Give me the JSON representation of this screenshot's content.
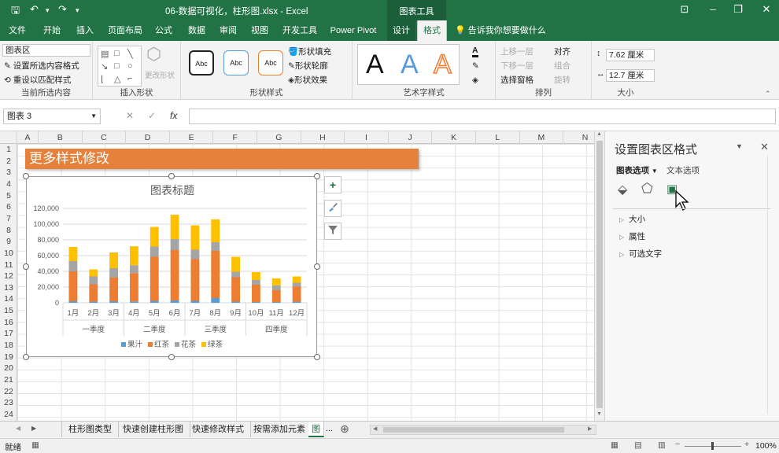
{
  "window": {
    "title": "06-数据可视化，柱形图.xlsx  -  Excel",
    "context_tools": "图表工具"
  },
  "tabs": [
    "文件",
    "开始",
    "插入",
    "页面布局",
    "公式",
    "数据",
    "审阅",
    "视图",
    "开发工具",
    "Power Pivot",
    "设计",
    "格式"
  ],
  "active_tab": "格式",
  "tell_me": "告诉我你想要做什么",
  "ribbon": {
    "current_selection": {
      "combo_value": "图表区",
      "format_selection": "设置所选内容格式",
      "reset_style": "重设以匹配样式",
      "label": "当前所选内容"
    },
    "insert_shapes": {
      "change_shape": "更改形状",
      "label": "插入形状"
    },
    "shape_styles": {
      "preset_text": "Abc",
      "fill": "形状填充",
      "outline": "形状轮廓",
      "effects": "形状效果",
      "label": "形状样式"
    },
    "wordart": {
      "glyph": "A",
      "label": "艺术字样式"
    },
    "arrange": {
      "bring_forward": "上移一层",
      "send_backward": "下移一层",
      "selection_pane": "选择窗格",
      "align": "对齐",
      "group": "组合",
      "rotate": "旋转",
      "label": "排列"
    },
    "size": {
      "height": "7.62 厘米",
      "width": "12.7 厘米",
      "label": "大小"
    }
  },
  "formula_bar": {
    "name_box": "图表 3",
    "fx": "fx",
    "formula": ""
  },
  "columns": [
    "A",
    "B",
    "C",
    "D",
    "E",
    "F",
    "G",
    "H",
    "I",
    "J",
    "K",
    "L",
    "M",
    "N"
  ],
  "rows": [
    "1",
    "2",
    "3",
    "4",
    "5",
    "6",
    "7",
    "8",
    "9",
    "10",
    "11",
    "12",
    "13",
    "14",
    "15",
    "16",
    "17",
    "18",
    "19",
    "20",
    "21",
    "22",
    "23",
    "24"
  ],
  "banner_text": "更多样式修改",
  "chart_data": {
    "type": "bar",
    "stacked": true,
    "title": "图表标题",
    "categories": [
      "1月",
      "2月",
      "3月",
      "4月",
      "5月",
      "6月",
      "7月",
      "8月",
      "9月",
      "10月",
      "11月",
      "12月"
    ],
    "groups": [
      {
        "label": "一季度",
        "span": 3
      },
      {
        "label": "二季度",
        "span": 3
      },
      {
        "label": "三季度",
        "span": 3
      },
      {
        "label": "四季度",
        "span": 3
      }
    ],
    "series": [
      {
        "name": "果汁",
        "color": "#5b9bd5",
        "values": [
          2000,
          1500,
          2000,
          1800,
          2500,
          3000,
          2500,
          6000,
          1500,
          1000,
          1000,
          1500
        ]
      },
      {
        "name": "红茶",
        "color": "#ed7d31",
        "values": [
          38000,
          22000,
          30000,
          36000,
          56000,
          64000,
          53000,
          60000,
          31000,
          22000,
          15000,
          19000
        ]
      },
      {
        "name": "花茶",
        "color": "#a5a5a5",
        "values": [
          13000,
          10000,
          12000,
          10000,
          13000,
          14000,
          12000,
          11000,
          7000,
          6000,
          6000,
          5000
        ]
      },
      {
        "name": "绿茶",
        "color": "#ffc000",
        "values": [
          18000,
          9000,
          20000,
          24000,
          25000,
          31000,
          31000,
          29000,
          19000,
          10000,
          9000,
          8000
        ]
      }
    ],
    "ylim": [
      0,
      120000
    ],
    "yticks": [
      "120,000",
      "100,000",
      "80,000",
      "60,000",
      "40,000",
      "20,000",
      "0"
    ],
    "grid": true,
    "legend_position": "bottom"
  },
  "side_buttons": [
    "+",
    "brush",
    "filter"
  ],
  "pane": {
    "title": "设置图表区格式",
    "tab_chart_options": "图表选项",
    "tab_text_options": "文本选项",
    "sections": [
      "大小",
      "属性",
      "可选文字"
    ]
  },
  "sheet_tabs": [
    "柱形图类型",
    "快速创建柱形图",
    "快速修改样式",
    "按需添加元素",
    "图"
  ],
  "more_tabs": "...",
  "status": {
    "ready": "就绪",
    "zoom": "100%"
  },
  "colors": {
    "excel_green": "#217346",
    "banner": "#e5813b"
  }
}
